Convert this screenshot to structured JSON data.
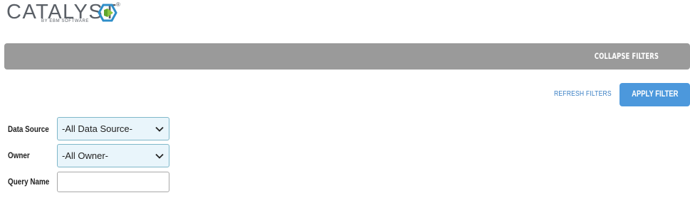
{
  "logo": {
    "wordmark": "CATALYST",
    "tagline": "BY EBM SOFTWARE",
    "registered": "®",
    "mark_colors": [
      "#2e8ec9",
      "#8cc63f",
      "#5a5f66"
    ]
  },
  "filter_bar": {
    "collapse_label": "COLLAPSE FILTERS",
    "color": "#9a9a9a"
  },
  "actions": {
    "refresh_label": "REFRESH FILTERS",
    "apply_label": "APPLY FILTER",
    "apply_color": "#4c98dc"
  },
  "filters": {
    "data_source": {
      "label": "Data Source",
      "selected": "-All Data Source-"
    },
    "owner": {
      "label": "Owner",
      "selected": "-All Owner-"
    },
    "query_name": {
      "label": "Query Name",
      "value": ""
    }
  }
}
